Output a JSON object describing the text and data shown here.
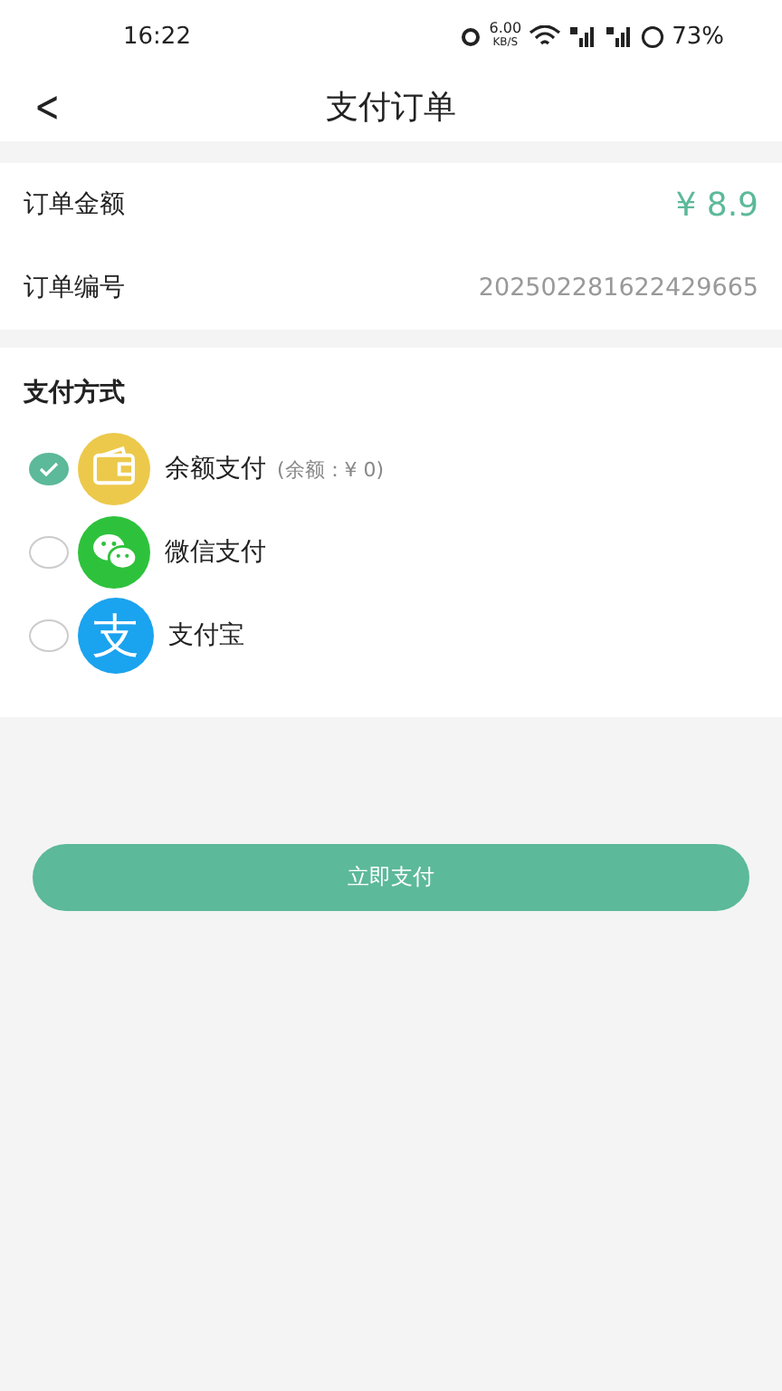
{
  "status_bar": {
    "time": "16:22",
    "speed": "6.00",
    "speed_unit": "KB/S",
    "battery": "73%"
  },
  "nav": {
    "back": "<",
    "title": "支付订单"
  },
  "order": [
    {
      "label": "订单金额",
      "value": "¥ 8.9",
      "kind": "amount"
    },
    {
      "label": "订单编号",
      "value": "202502281622429665",
      "kind": "number"
    }
  ],
  "payment": {
    "title": "支付方式",
    "methods": [
      {
        "kind": "wallet",
        "name": "余额支付",
        "note": "(余额：¥ 0)",
        "selected": true
      },
      {
        "kind": "wechat",
        "name": "微信支付",
        "selected": false
      },
      {
        "kind": "alipay",
        "name": "支付宝",
        "icon_text": "支",
        "selected": false
      }
    ]
  },
  "submit": "立即支付"
}
